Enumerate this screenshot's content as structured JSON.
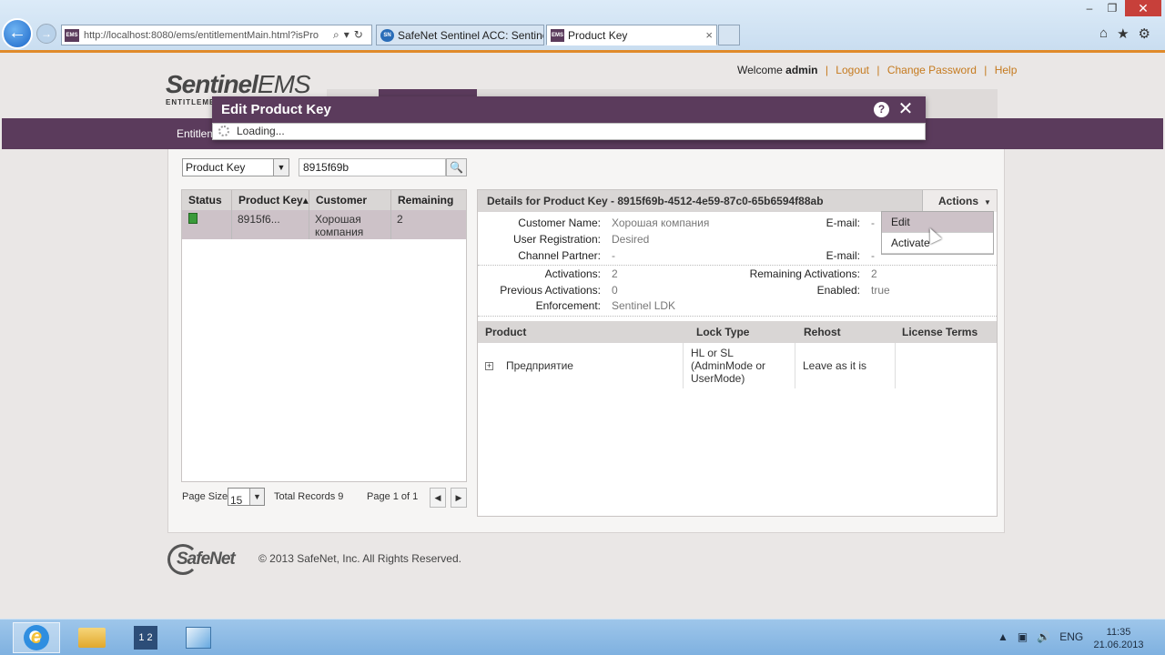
{
  "browser": {
    "address_url": "http://localhost:8080/ems/entitlementMain.html?isPro",
    "address_favicon": "EMS",
    "tabs": [
      {
        "label": "SafeNet Sentinel ACC: Sentinel...",
        "favicon": "SN",
        "active": false
      },
      {
        "label": "Product Key",
        "favicon": "EMS",
        "active": true
      }
    ],
    "tab_close": "×",
    "win_min": "–",
    "win_max": "❐",
    "win_close": "✕",
    "home_icon": "⌂",
    "fav_icon": "★",
    "settings_icon": "⚙",
    "back": "←",
    "forward": "→"
  },
  "header": {
    "logo_line1_bold": "Sentinel",
    "logo_line1_thin": "EMS",
    "logo_line2": "ENTITLEMENT",
    "welcome_prefix": "Welcome",
    "username": "admin",
    "logout": "Logout",
    "change_password": "Change Password",
    "help": "Help",
    "separator": "|",
    "nav_first": "Entitlem"
  },
  "search": {
    "field": "Product Key",
    "value": "8915f69b"
  },
  "list": {
    "columns": [
      "Status",
      "Product Key",
      "Customer",
      "Remaining"
    ],
    "sort_indicator": "▴",
    "rows": [
      {
        "product_key": "8915f6...",
        "customer_l1": "Хорошая",
        "customer_l2": "компания",
        "remaining": "2"
      }
    ]
  },
  "pager": {
    "page_size_label": "Page Size",
    "page_size": "15",
    "total_records": "Total Records 9",
    "page_info": "Page 1 of 1",
    "prev": "◀",
    "next": "▶"
  },
  "details": {
    "title": "Details for Product Key - 8915f69b-4512-4e59-87c0-65b6594f88ab",
    "actions_label": "Actions",
    "actions_menu": [
      "Edit",
      "Activate"
    ],
    "customer_name_label": "Customer Name:",
    "customer_name": "Хорошая компания",
    "email_label": "E-mail:",
    "email_value": "-",
    "user_registration_label": "User Registration:",
    "user_registration": "Desired",
    "channel_partner_label": "Channel Partner:",
    "channel_partner": "-",
    "email2_label": "E-mail:",
    "email2_value": "-",
    "activations_label": "Activations:",
    "activations": "2",
    "remaining_activations_label": "Remaining Activations:",
    "remaining_activations": "2",
    "previous_activations_label": "Previous Activations:",
    "previous_activations": "0",
    "enabled_label": "Enabled:",
    "enabled": "true",
    "enforcement_label": "Enforcement:",
    "enforcement": "Sentinel LDK"
  },
  "products": {
    "columns": [
      "Product",
      "Lock Type",
      "Rehost",
      "License Terms"
    ],
    "rows": [
      {
        "expander": "+",
        "product": "Предприятие",
        "lock_l1": "HL or SL",
        "lock_l2": "(AdminMode or",
        "lock_l3": "UserMode)",
        "rehost": "Leave as it is",
        "license_terms": ""
      }
    ]
  },
  "footer": {
    "logo_text": "SafeNet",
    "copyright": "© 2013 SafeNet, Inc. All Rights Reserved."
  },
  "modal": {
    "title": "Edit Product Key",
    "help": "?",
    "close": "✕",
    "loading": "Loading..."
  },
  "taskbar": {
    "language": "ENG",
    "time": "11:35",
    "date": "21.06.2013",
    "tray_up": "▲",
    "blocks_label": "1 2"
  },
  "colors": {
    "brand_purple": "#5b3b5c",
    "accent_orange": "#c57a1e",
    "selected_row": "#cdc2c8"
  }
}
